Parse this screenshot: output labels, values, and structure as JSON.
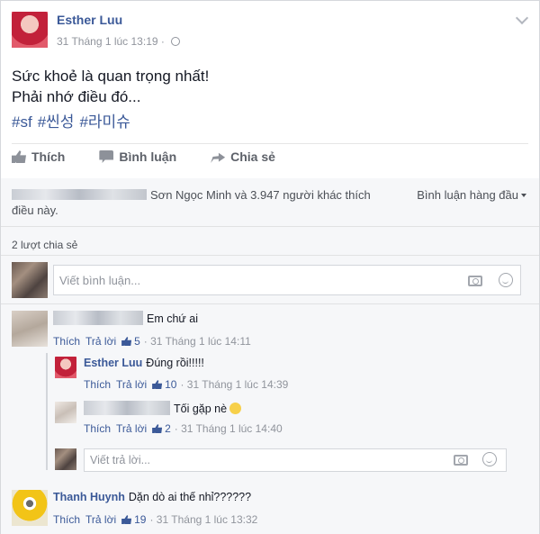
{
  "post": {
    "author": "Esther Luu",
    "timestamp": "31 Tháng 1 lúc 13:19 · ",
    "text_line1": "Sức khoẻ là quan trọng nhất!",
    "text_line2": "Phải nhớ điều đó...",
    "hashtags": [
      "#sf",
      "#씬성",
      "#라미슈"
    ]
  },
  "actions": {
    "like": "Thích",
    "comment": "Bình luận",
    "share": "Chia sẻ"
  },
  "engagement": {
    "likes_text": "Sơn Ngọc Minh và 3.947 người khác thích",
    "likes_text2": "điều này.",
    "sort_label": "Bình luận hàng đầu",
    "shares": "2 lượt chia sẻ"
  },
  "composer": {
    "placeholder": "Viết bình luận...",
    "reply_placeholder": "Viết trả lời..."
  },
  "comments": [
    {
      "text": "Em chứ ai",
      "like_label": "Thích",
      "reply_label": "Trả lời",
      "likes": "5",
      "time": "· 31 Tháng 1 lúc 14:11",
      "replies": [
        {
          "name": "Esther Luu",
          "text": "Đúng rồi!!!!!",
          "like_label": "Thích",
          "reply_label": "Trả lời",
          "likes": "10",
          "time": "· 31 Tháng 1 lúc 14:39"
        },
        {
          "text": "Tối gặp nè",
          "like_label": "Thích",
          "reply_label": "Trả lời",
          "likes": "2",
          "time": "· 31 Tháng 1 lúc 14:40"
        }
      ]
    },
    {
      "name": "Thanh Huynh",
      "text": "Dặn dò ai thế nhỉ??????",
      "like_label": "Thích",
      "reply_label": "Trả lời",
      "likes": "19",
      "time": "· 31 Tháng 1 lúc 13:32"
    }
  ]
}
